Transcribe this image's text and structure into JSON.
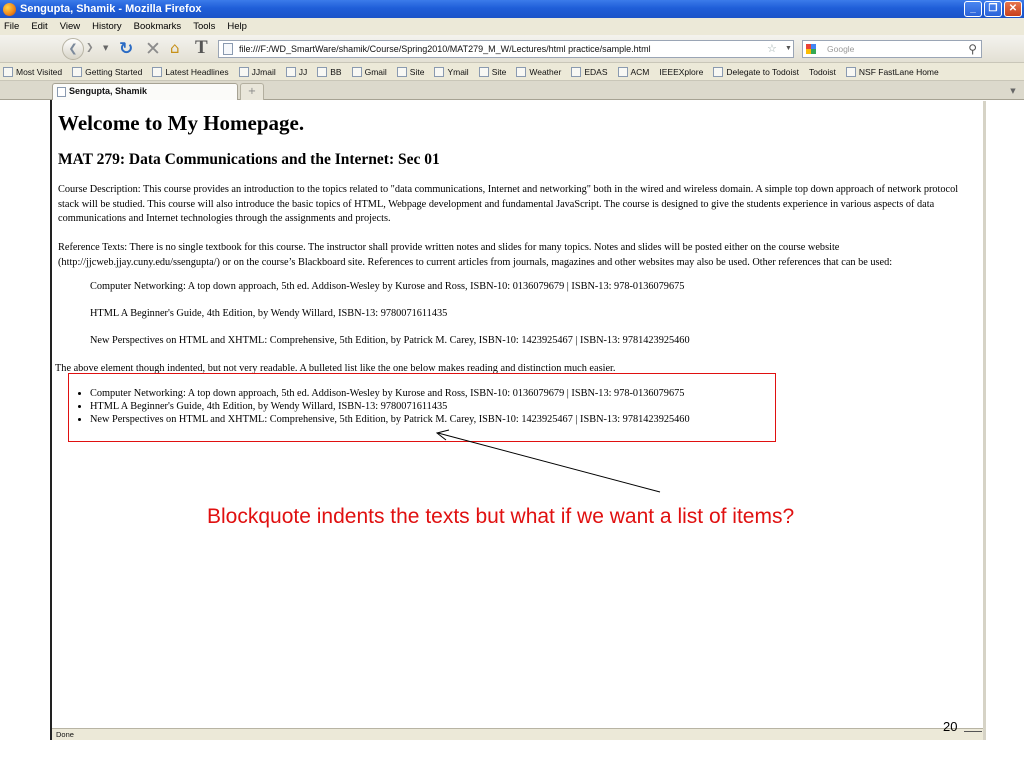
{
  "window": {
    "title": "Sengupta, Shamik - Mozilla Firefox",
    "controls": [
      "_",
      "❐",
      "✕"
    ]
  },
  "menu": [
    "File",
    "Edit",
    "View",
    "History",
    "Bookmarks",
    "Tools",
    "Help"
  ],
  "navbar": {
    "url": "file:///F:/WD_SmartWare/shamik/Course/Spring2010/MAT279_M_W/Lectures/html practice/sample.html",
    "search_placeholder": "Google"
  },
  "bookmarks": [
    "Most Visited",
    "Getting Started",
    "Latest Headlines",
    "JJmail",
    "JJ",
    "BB",
    "Gmail",
    "Site",
    "Ymail",
    "Site",
    "Weather",
    "EDAS",
    "ACM",
    "IEEEXplore",
    "Delegate to Todoist",
    "Todoist",
    "NSF FastLane Home"
  ],
  "tab": {
    "title": "Sengupta, Shamik",
    "new_tab": "+"
  },
  "page": {
    "heading": "Welcome to My Homepage.",
    "subheading": "MAT 279: Data Communications and the Internet: Sec 01",
    "course_description": "Course Description: This course provides an introduction to the topics related to \"data communications, Internet and networking\" both in the wired and wireless domain. A simple top down approach of network protocol stack will be studied. This course will also introduce the basic topics of HTML, Webpage development and fundamental JavaScript. The course is designed to give the students experience in various aspects of data communications and Internet technologies through the assignments and projects.",
    "reference_texts": "Reference Texts: There is no single textbook for this course. The instructor shall provide written notes and slides for many topics. Notes and slides will be posted either on the course website (http://jjcweb.jjay.cuny.edu/ssengupta/) or on the course’s Blackboard site. References to current articles from journals, magazines and other websites may also be used. Other references that can be used:",
    "blockquote_items": [
      "Computer Networking: A top down approach, 5th ed. Addison-Wesley by Kurose and Ross, ISBN-10: 0136079679 | ISBN-13: 978-0136079675",
      "HTML A Beginner's Guide, 4th Edition, by Wendy Willard, ISBN-13: 9780071611435",
      "New Perspectives on HTML and XHTML: Comprehensive, 5th Edition, by Patrick M. Carey, ISBN-10: 1423925467 | ISBN-13: 9781423925460"
    ],
    "note": "The above element though indented, but not very readable. A bulleted list like the one below makes reading and distinction much easier.",
    "list_items": [
      "Computer Networking: A top down approach, 5th ed. Addison-Wesley by Kurose and Ross, ISBN-10: 0136079679 | ISBN-13: 978-0136079675",
      "HTML A Beginner's Guide, 4th Edition, by Wendy Willard, ISBN-13: 9780071611435",
      "New Perspectives on HTML and XHTML: Comprehensive, 5th Edition, by Patrick M. Carey, ISBN-10: 1423925467 | ISBN-13: 9781423925460"
    ]
  },
  "annotation": {
    "callout": "Blockquote indents the texts but what if we want a list of items?",
    "color": "#e01010"
  },
  "status": "Done",
  "slide_number": "20"
}
